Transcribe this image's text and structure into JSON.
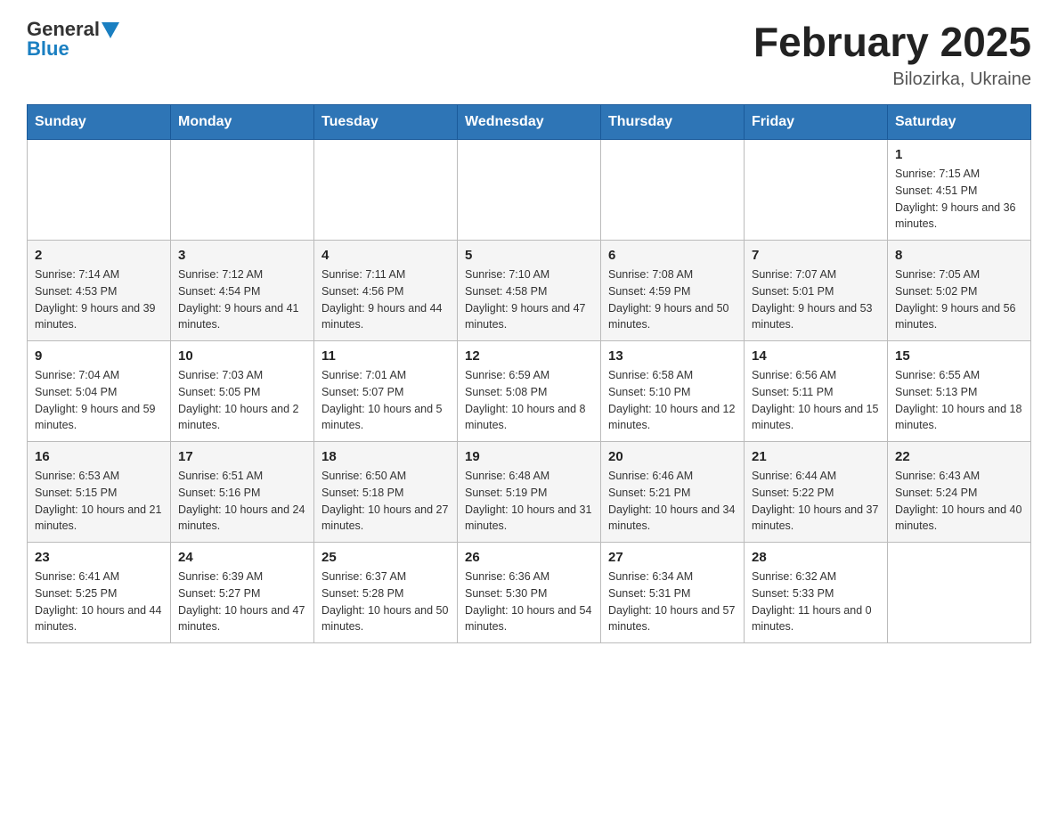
{
  "header": {
    "logo_general": "General",
    "logo_blue": "Blue",
    "month_title": "February 2025",
    "location": "Bilozirka, Ukraine"
  },
  "days_of_week": [
    "Sunday",
    "Monday",
    "Tuesday",
    "Wednesday",
    "Thursday",
    "Friday",
    "Saturday"
  ],
  "weeks": [
    [
      {
        "day": "",
        "info": ""
      },
      {
        "day": "",
        "info": ""
      },
      {
        "day": "",
        "info": ""
      },
      {
        "day": "",
        "info": ""
      },
      {
        "day": "",
        "info": ""
      },
      {
        "day": "",
        "info": ""
      },
      {
        "day": "1",
        "info": "Sunrise: 7:15 AM\nSunset: 4:51 PM\nDaylight: 9 hours and 36 minutes."
      }
    ],
    [
      {
        "day": "2",
        "info": "Sunrise: 7:14 AM\nSunset: 4:53 PM\nDaylight: 9 hours and 39 minutes."
      },
      {
        "day": "3",
        "info": "Sunrise: 7:12 AM\nSunset: 4:54 PM\nDaylight: 9 hours and 41 minutes."
      },
      {
        "day": "4",
        "info": "Sunrise: 7:11 AM\nSunset: 4:56 PM\nDaylight: 9 hours and 44 minutes."
      },
      {
        "day": "5",
        "info": "Sunrise: 7:10 AM\nSunset: 4:58 PM\nDaylight: 9 hours and 47 minutes."
      },
      {
        "day": "6",
        "info": "Sunrise: 7:08 AM\nSunset: 4:59 PM\nDaylight: 9 hours and 50 minutes."
      },
      {
        "day": "7",
        "info": "Sunrise: 7:07 AM\nSunset: 5:01 PM\nDaylight: 9 hours and 53 minutes."
      },
      {
        "day": "8",
        "info": "Sunrise: 7:05 AM\nSunset: 5:02 PM\nDaylight: 9 hours and 56 minutes."
      }
    ],
    [
      {
        "day": "9",
        "info": "Sunrise: 7:04 AM\nSunset: 5:04 PM\nDaylight: 9 hours and 59 minutes."
      },
      {
        "day": "10",
        "info": "Sunrise: 7:03 AM\nSunset: 5:05 PM\nDaylight: 10 hours and 2 minutes."
      },
      {
        "day": "11",
        "info": "Sunrise: 7:01 AM\nSunset: 5:07 PM\nDaylight: 10 hours and 5 minutes."
      },
      {
        "day": "12",
        "info": "Sunrise: 6:59 AM\nSunset: 5:08 PM\nDaylight: 10 hours and 8 minutes."
      },
      {
        "day": "13",
        "info": "Sunrise: 6:58 AM\nSunset: 5:10 PM\nDaylight: 10 hours and 12 minutes."
      },
      {
        "day": "14",
        "info": "Sunrise: 6:56 AM\nSunset: 5:11 PM\nDaylight: 10 hours and 15 minutes."
      },
      {
        "day": "15",
        "info": "Sunrise: 6:55 AM\nSunset: 5:13 PM\nDaylight: 10 hours and 18 minutes."
      }
    ],
    [
      {
        "day": "16",
        "info": "Sunrise: 6:53 AM\nSunset: 5:15 PM\nDaylight: 10 hours and 21 minutes."
      },
      {
        "day": "17",
        "info": "Sunrise: 6:51 AM\nSunset: 5:16 PM\nDaylight: 10 hours and 24 minutes."
      },
      {
        "day": "18",
        "info": "Sunrise: 6:50 AM\nSunset: 5:18 PM\nDaylight: 10 hours and 27 minutes."
      },
      {
        "day": "19",
        "info": "Sunrise: 6:48 AM\nSunset: 5:19 PM\nDaylight: 10 hours and 31 minutes."
      },
      {
        "day": "20",
        "info": "Sunrise: 6:46 AM\nSunset: 5:21 PM\nDaylight: 10 hours and 34 minutes."
      },
      {
        "day": "21",
        "info": "Sunrise: 6:44 AM\nSunset: 5:22 PM\nDaylight: 10 hours and 37 minutes."
      },
      {
        "day": "22",
        "info": "Sunrise: 6:43 AM\nSunset: 5:24 PM\nDaylight: 10 hours and 40 minutes."
      }
    ],
    [
      {
        "day": "23",
        "info": "Sunrise: 6:41 AM\nSunset: 5:25 PM\nDaylight: 10 hours and 44 minutes."
      },
      {
        "day": "24",
        "info": "Sunrise: 6:39 AM\nSunset: 5:27 PM\nDaylight: 10 hours and 47 minutes."
      },
      {
        "day": "25",
        "info": "Sunrise: 6:37 AM\nSunset: 5:28 PM\nDaylight: 10 hours and 50 minutes."
      },
      {
        "day": "26",
        "info": "Sunrise: 6:36 AM\nSunset: 5:30 PM\nDaylight: 10 hours and 54 minutes."
      },
      {
        "day": "27",
        "info": "Sunrise: 6:34 AM\nSunset: 5:31 PM\nDaylight: 10 hours and 57 minutes."
      },
      {
        "day": "28",
        "info": "Sunrise: 6:32 AM\nSunset: 5:33 PM\nDaylight: 11 hours and 0 minutes."
      },
      {
        "day": "",
        "info": ""
      }
    ]
  ]
}
